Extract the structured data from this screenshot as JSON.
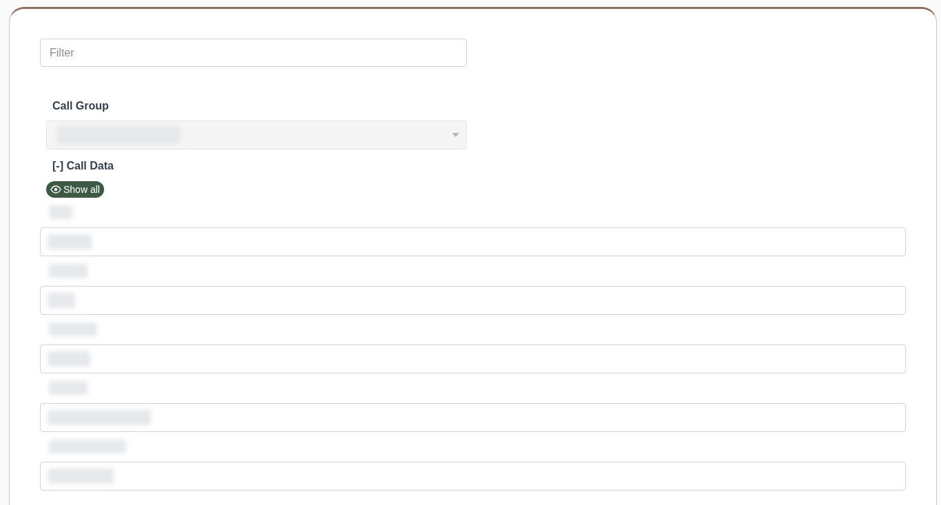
{
  "filter": {
    "placeholder": "Filter"
  },
  "call_group": {
    "label": "Call Group",
    "disabled": true,
    "value": {
      "kind": "blurred"
    }
  },
  "call_data": {
    "title": "[-] Call Data",
    "show_all": "Show all",
    "fields": [
      {
        "kind": "blurred"
      },
      {
        "kind": "blurred"
      },
      {
        "kind": "blurred"
      },
      {
        "kind": "blurred"
      },
      {
        "kind": "blurred"
      }
    ]
  }
}
